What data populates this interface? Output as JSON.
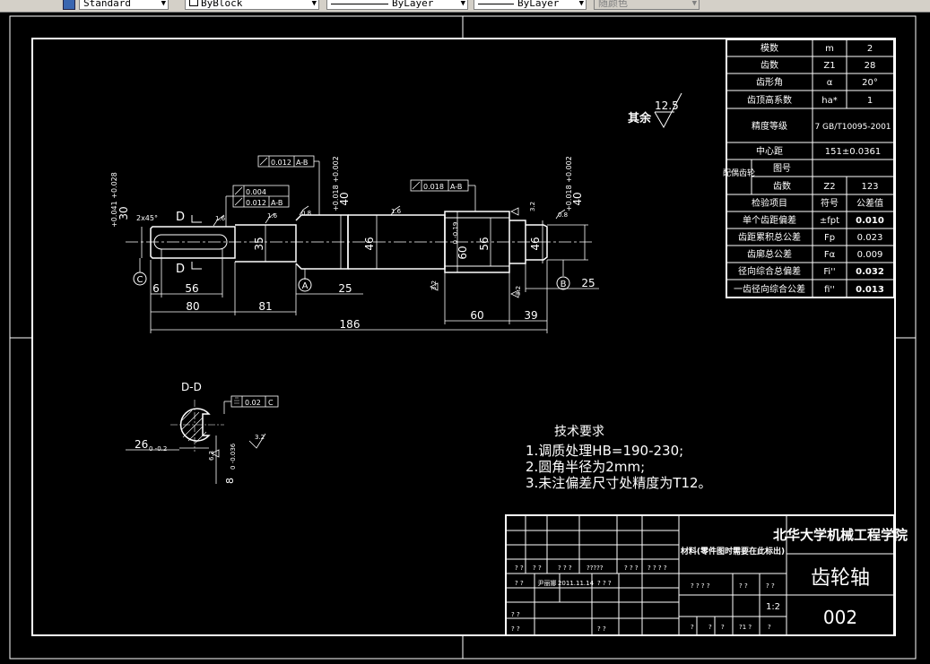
{
  "toolbar": {
    "text_style": "Standard",
    "layer_color": "ByBlock",
    "linetype": "ByLayer",
    "lineweight": "ByLayer",
    "plot_style": "随颜色"
  },
  "drawing": {
    "title_block": {
      "school": "北华大学机械工程学院",
      "part_name": "齿轮轴",
      "drawing_no": "002",
      "material_note": "材料(零件图时需要在此标出)",
      "scale": "1:2",
      "designer": "尹丽娜",
      "date": "2011.11.14",
      "placeholders": {
        "q2": "? ?",
        "q4": "? ? ? ?",
        "q5": "?????",
        "q3": "? ? ?",
        "q1": "?",
        "q1b": "?1 ?",
        "q3b": "? ?"
      }
    },
    "roughness_note": "其余",
    "roughness_value": "12.5",
    "section_label": "D-D",
    "section_d": "D",
    "tech_req_title": "技术要求",
    "tech_req": [
      "1.调质处理HB=190-230;",
      "2.圆角半径为2mm;",
      "3.未注偏差尺寸处精度为T12。"
    ],
    "param_table": [
      [
        "模数",
        "m",
        "2"
      ],
      [
        "齿数",
        "Z1",
        "28"
      ],
      [
        "齿形角",
        "α",
        "20°"
      ],
      [
        "齿顶高系数",
        "ha*",
        "1"
      ],
      [
        "精度等级",
        "",
        "7 GB/T10095-2001"
      ],
      [
        "中心距",
        "",
        "151±0.0361"
      ],
      [
        "图号",
        "",
        ""
      ],
      [
        "齿数",
        "Z2",
        "123"
      ],
      [
        "检验项目",
        "符号",
        "公差值"
      ],
      [
        "单个齿距偏差",
        "±fpt",
        "0.010"
      ],
      [
        "齿距累积总公差",
        "Fp",
        "0.023"
      ],
      [
        "齿廓总公差",
        "Fα",
        "0.009"
      ],
      [
        "径向综合总偏差",
        "Fi''",
        "0.032"
      ],
      [
        "一齿径向综合公差",
        "fi''",
        "0.013"
      ]
    ],
    "mating_gear_label": "配偶齿轮",
    "dims": {
      "d186": "186",
      "d80": "80",
      "d81": "81",
      "d56a": "56",
      "d6": "6",
      "d25a": "25",
      "d25b": "25",
      "d60": "60",
      "d39": "39",
      "d35": "35",
      "d46a": "46",
      "d56b": "56",
      "d46b": "46",
      "d30": "30",
      "d30tol": "+0.041 +0.028",
      "d40a": "40",
      "d40atol": "+0.018 +0.002",
      "d40b": "40",
      "d40btol": "+0.018 +0.002",
      "d60tip": "60",
      "d60tol": "0 -0.19",
      "d26": "26",
      "d26tol": "0 -0.2",
      "d8": "8",
      "d8tol": "0 -0.036",
      "chamfer": "2x45°",
      "tol_runout1": "0.012",
      "tol_runout1_ref": "A-B",
      "tol_flat": "0.004",
      "tol_runout2": "0.012",
      "tol_runout2_ref": "A-B",
      "tol_runout3": "0.018",
      "tol_runout3_ref": "A-B",
      "tol_sym": "0.02",
      "tol_sym_ref": "C",
      "datum_a": "A",
      "datum_b": "B",
      "datum_c": "C",
      "r16a": "1.6",
      "r16b": "1.6",
      "r16c": "1.6",
      "r08a": "0.8",
      "r08b": "0.8",
      "r32a": "3.2",
      "r32b": "3.2",
      "r32c": "3.2",
      "r32d": "3.2",
      "r63": "6.3"
    }
  }
}
